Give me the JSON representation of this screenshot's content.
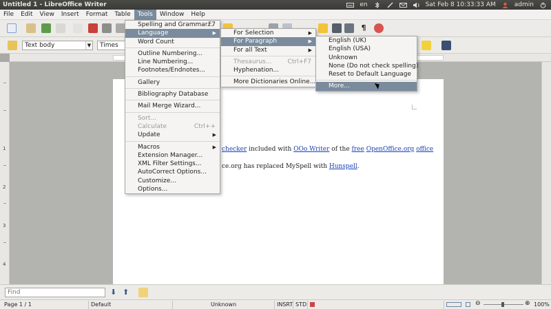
{
  "window": {
    "title": "Untitled 1 - LibreOffice Writer"
  },
  "tray": {
    "keyboard": "en",
    "clock": "Sat Feb  8 10:33:33 AM",
    "user": "admin"
  },
  "menubar": [
    "File",
    "Edit",
    "View",
    "Insert",
    "Format",
    "Table",
    "Tools",
    "Window",
    "Help"
  ],
  "toolbar": {
    "paragraph_style": "Text body",
    "font_name": "Times Ne"
  },
  "tools_menu": {
    "groups": [
      [
        {
          "label": "Spelling and Grammar...",
          "accel": "F7"
        },
        {
          "label": "Language",
          "submenu": true,
          "highlighted": true
        },
        {
          "label": "Word Count"
        }
      ],
      [
        {
          "label": "Outline Numbering..."
        },
        {
          "label": "Line Numbering..."
        },
        {
          "label": "Footnotes/Endnotes..."
        }
      ],
      [
        {
          "label": "Gallery"
        }
      ],
      [
        {
          "label": "Bibliography Database"
        }
      ],
      [
        {
          "label": "Mail Merge Wizard..."
        }
      ],
      [
        {
          "label": "Sort...",
          "disabled": true
        },
        {
          "label": "Calculate",
          "accel": "Ctrl++",
          "disabled": true
        },
        {
          "label": "Update",
          "submenu": true
        }
      ],
      [
        {
          "label": "Macros",
          "submenu": true
        },
        {
          "label": "Extension Manager..."
        },
        {
          "label": "XML Filter Settings..."
        },
        {
          "label": "AutoCorrect Options..."
        },
        {
          "label": "Customize..."
        },
        {
          "label": "Options..."
        }
      ]
    ]
  },
  "language_menu": {
    "groups": [
      [
        {
          "label": "For Selection",
          "submenu": true
        },
        {
          "label": "For Paragraph",
          "submenu": true,
          "highlighted": true
        },
        {
          "label": "For all Text",
          "submenu": true
        }
      ],
      [
        {
          "label": "Thesaurus...",
          "accel": "Ctrl+F7",
          "disabled": true
        },
        {
          "label": "Hyphenation..."
        }
      ],
      [
        {
          "label": "More Dictionaries Online..."
        }
      ]
    ]
  },
  "paragraph_menu": {
    "groups": [
      [
        {
          "label": "English (UK)"
        },
        {
          "label": "English (USA)"
        },
        {
          "label": "Unknown"
        },
        {
          "label": "None (Do not check spelling)"
        },
        {
          "label": "Reset to Default Language"
        }
      ],
      [
        {
          "label": "More...",
          "highlighted": true
        }
      ]
    ]
  },
  "document": {
    "line1": [
      {
        "text": "checker",
        "link": true
      },
      {
        "text": " included with "
      },
      {
        "text": "OOo Writer",
        "link": true
      },
      {
        "text": " of the "
      },
      {
        "text": "free",
        "link": true
      },
      {
        "text": " "
      },
      {
        "text": "OpenOffice.org",
        "link": true
      },
      {
        "text": " "
      },
      {
        "text": "office ",
        "link": true
      }
    ],
    "line2": [
      {
        "text": "ce.org has replaced MySpell with "
      },
      {
        "text": "Hunspell",
        "link": true
      },
      {
        "text": "."
      }
    ]
  },
  "findbar": {
    "placeholder": "Find"
  },
  "statusbar": {
    "page": "Page 1 / 1",
    "style": "Default",
    "language": "Unknown",
    "insert_mode": "INSRT",
    "selection_mode": "STD",
    "zoom": "100%"
  }
}
